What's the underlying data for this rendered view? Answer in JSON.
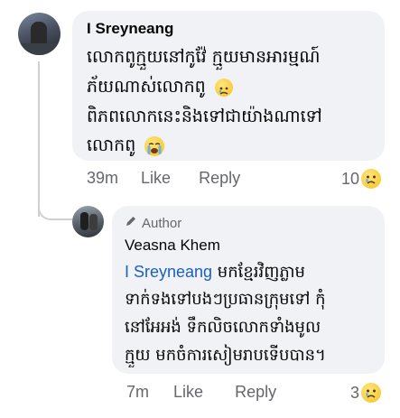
{
  "comment1": {
    "author_prefix": "I",
    "author": "Sreyneang",
    "lines": [
      "លោកពូក្មួយនៅកូវ៉ែ ក្មួយមានអារម្មណ៍",
      "ភ័យណាស់លោកពូ",
      "ពិភពលោកនេះនិងទៅជាយ៉ាងណាទៅ",
      "លោកពូ"
    ],
    "time": "39m",
    "like": "Like",
    "reply": "Reply",
    "reaction_count": "10",
    "reaction_icon": "sad-icon",
    "inline_emojis": [
      "sad-face",
      "crying-face"
    ]
  },
  "comment2": {
    "badge": "Author",
    "badge_icon": "pencil-icon",
    "author": "Veasna Khem",
    "mention": "I Sreyneang",
    "line1_rest": " មកខ្មែរវិញភ្លាម",
    "lines": [
      "ទាក់ទងទៅបងៗប្រធានក្រុមទៅ កុំ",
      "នៅអែអង់ ទឹកលិចលោកទាំងមូល",
      "ក្មួយ មកចំការសៀមរាបទើបបាន។"
    ],
    "time": "7m",
    "like": "Like",
    "reply": "Reply",
    "reaction_count": "3",
    "reaction_icon": "sad-icon"
  },
  "colors": {
    "bubble": "#f0f2f5",
    "meta": "#65676b",
    "mention": "#1b5fc2",
    "emoji": "#f5c11e"
  }
}
